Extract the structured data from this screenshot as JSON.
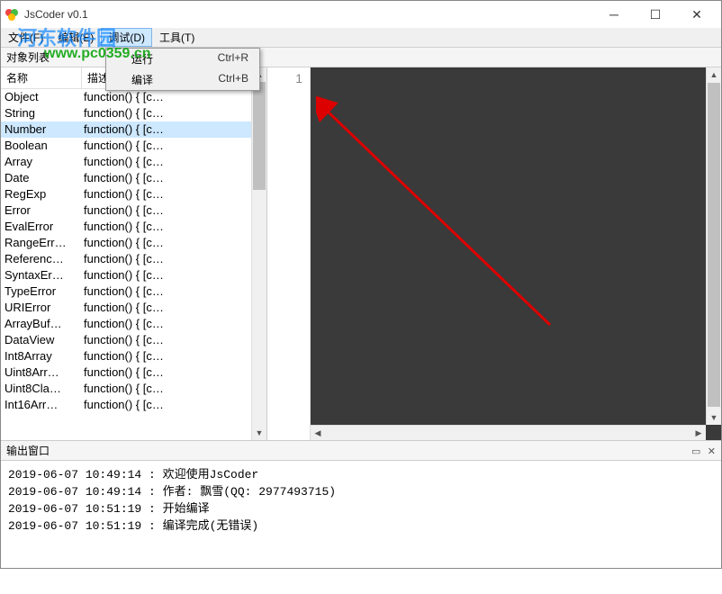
{
  "window": {
    "title": "JsCoder v0.1"
  },
  "menubar": {
    "items": [
      {
        "label": "文件(F)"
      },
      {
        "label": "编辑(E)"
      },
      {
        "label": "调试(D)",
        "active": true
      },
      {
        "label": "工具(T)"
      }
    ]
  },
  "dropdown": {
    "items": [
      {
        "label": "运行",
        "shortcut": "Ctrl+R"
      },
      {
        "label": "编译",
        "shortcut": "Ctrl+B"
      }
    ]
  },
  "sidebar": {
    "title": "对象列表",
    "columns": {
      "name": "名称",
      "desc": "描述"
    },
    "rows": [
      {
        "name": "Object",
        "desc": "function() { [c…"
      },
      {
        "name": "String",
        "desc": "function() { [c…"
      },
      {
        "name": "Number",
        "desc": "function() { [c…",
        "selected": true
      },
      {
        "name": "Boolean",
        "desc": "function() { [c…"
      },
      {
        "name": "Array",
        "desc": "function() { [c…"
      },
      {
        "name": "Date",
        "desc": "function() { [c…"
      },
      {
        "name": "RegExp",
        "desc": "function() { [c…"
      },
      {
        "name": "Error",
        "desc": "function() { [c…"
      },
      {
        "name": "EvalError",
        "desc": "function() { [c…"
      },
      {
        "name": "RangeErr…",
        "desc": "function() { [c…"
      },
      {
        "name": "Referenc…",
        "desc": "function() { [c…"
      },
      {
        "name": "SyntaxEr…",
        "desc": "function() { [c…"
      },
      {
        "name": "TypeError",
        "desc": "function() { [c…"
      },
      {
        "name": "URIError",
        "desc": "function() { [c…"
      },
      {
        "name": "ArrayBuf…",
        "desc": "function() { [c…"
      },
      {
        "name": "DataView",
        "desc": "function() { [c…"
      },
      {
        "name": "Int8Array",
        "desc": "function() { [c…"
      },
      {
        "name": "Uint8Arr…",
        "desc": "function() { [c…"
      },
      {
        "name": "Uint8Cla…",
        "desc": "function() { [c…"
      },
      {
        "name": "Int16Arr…",
        "desc": "function() { [c…"
      }
    ]
  },
  "editor": {
    "line_number": "1"
  },
  "output": {
    "title": "输出窗口",
    "lines": [
      "2019-06-07 10:49:14 : 欢迎使用JsCoder",
      "2019-06-07 10:49:14 : 作者: 飘雪(QQ: 2977493715)",
      "2019-06-07 10:51:19 : 开始编译",
      "2019-06-07 10:51:19 : 编译完成(无错误)"
    ]
  },
  "watermark": {
    "text1": "河东软件园",
    "text2": "www.pc0359.cn"
  }
}
